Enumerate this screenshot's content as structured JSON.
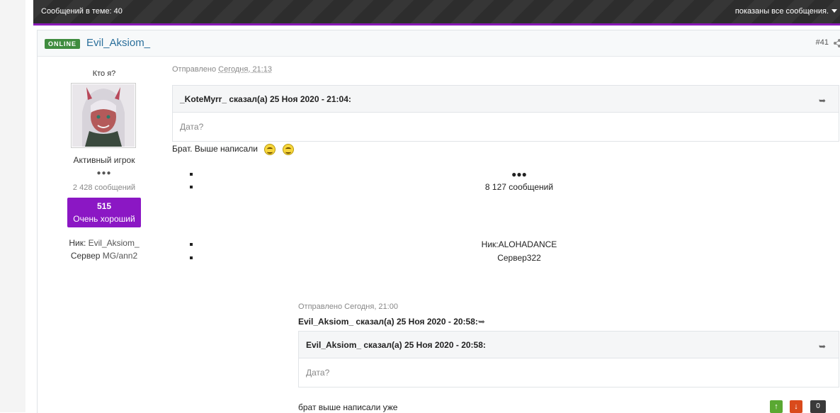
{
  "topbar": {
    "count_label": "Сообщений в теме: 40",
    "shown_label": "показаны все сообщения."
  },
  "post": {
    "status": "ONLINE",
    "author": "Evil_Aksiom_",
    "number": "#41",
    "sidebar": {
      "who": "Кто я?",
      "rank": "Активный игрок",
      "pips": "●●●",
      "posts": "2 428 сообщений",
      "rep_value": "515",
      "rep_title": "Очень хороший",
      "nick_label": "Ник:",
      "nick_value": "Evil_Aksiom_",
      "server_label": "Сервер",
      "server_value": "MG/ann2"
    },
    "posted_prefix": "Отправлено",
    "posted_time": "Сегодня, 21:13",
    "quote1": {
      "header": "_KoteMyrr_ сказал(а) 25 Ноя 2020 - 21:04:",
      "body": "Дата?"
    },
    "reply_text": "Брат. Выше написали",
    "embedded": {
      "pips": "●●●",
      "posts": "8 127 сообщений",
      "nick": "Ник:ALOHADANCE",
      "server": "Сервер322",
      "posted": "Отправлено Сегодня, 21:00",
      "header": "Evil_Aksiom_ сказал(а) 25 Ноя 2020 - 20:58:",
      "quote": {
        "header": "Evil_Aksiom_ сказал(а) 25 Ноя 2020 - 20:58:",
        "body": "Дата?"
      },
      "text": "брат выше написали уже"
    },
    "votes": {
      "count": "0"
    }
  }
}
